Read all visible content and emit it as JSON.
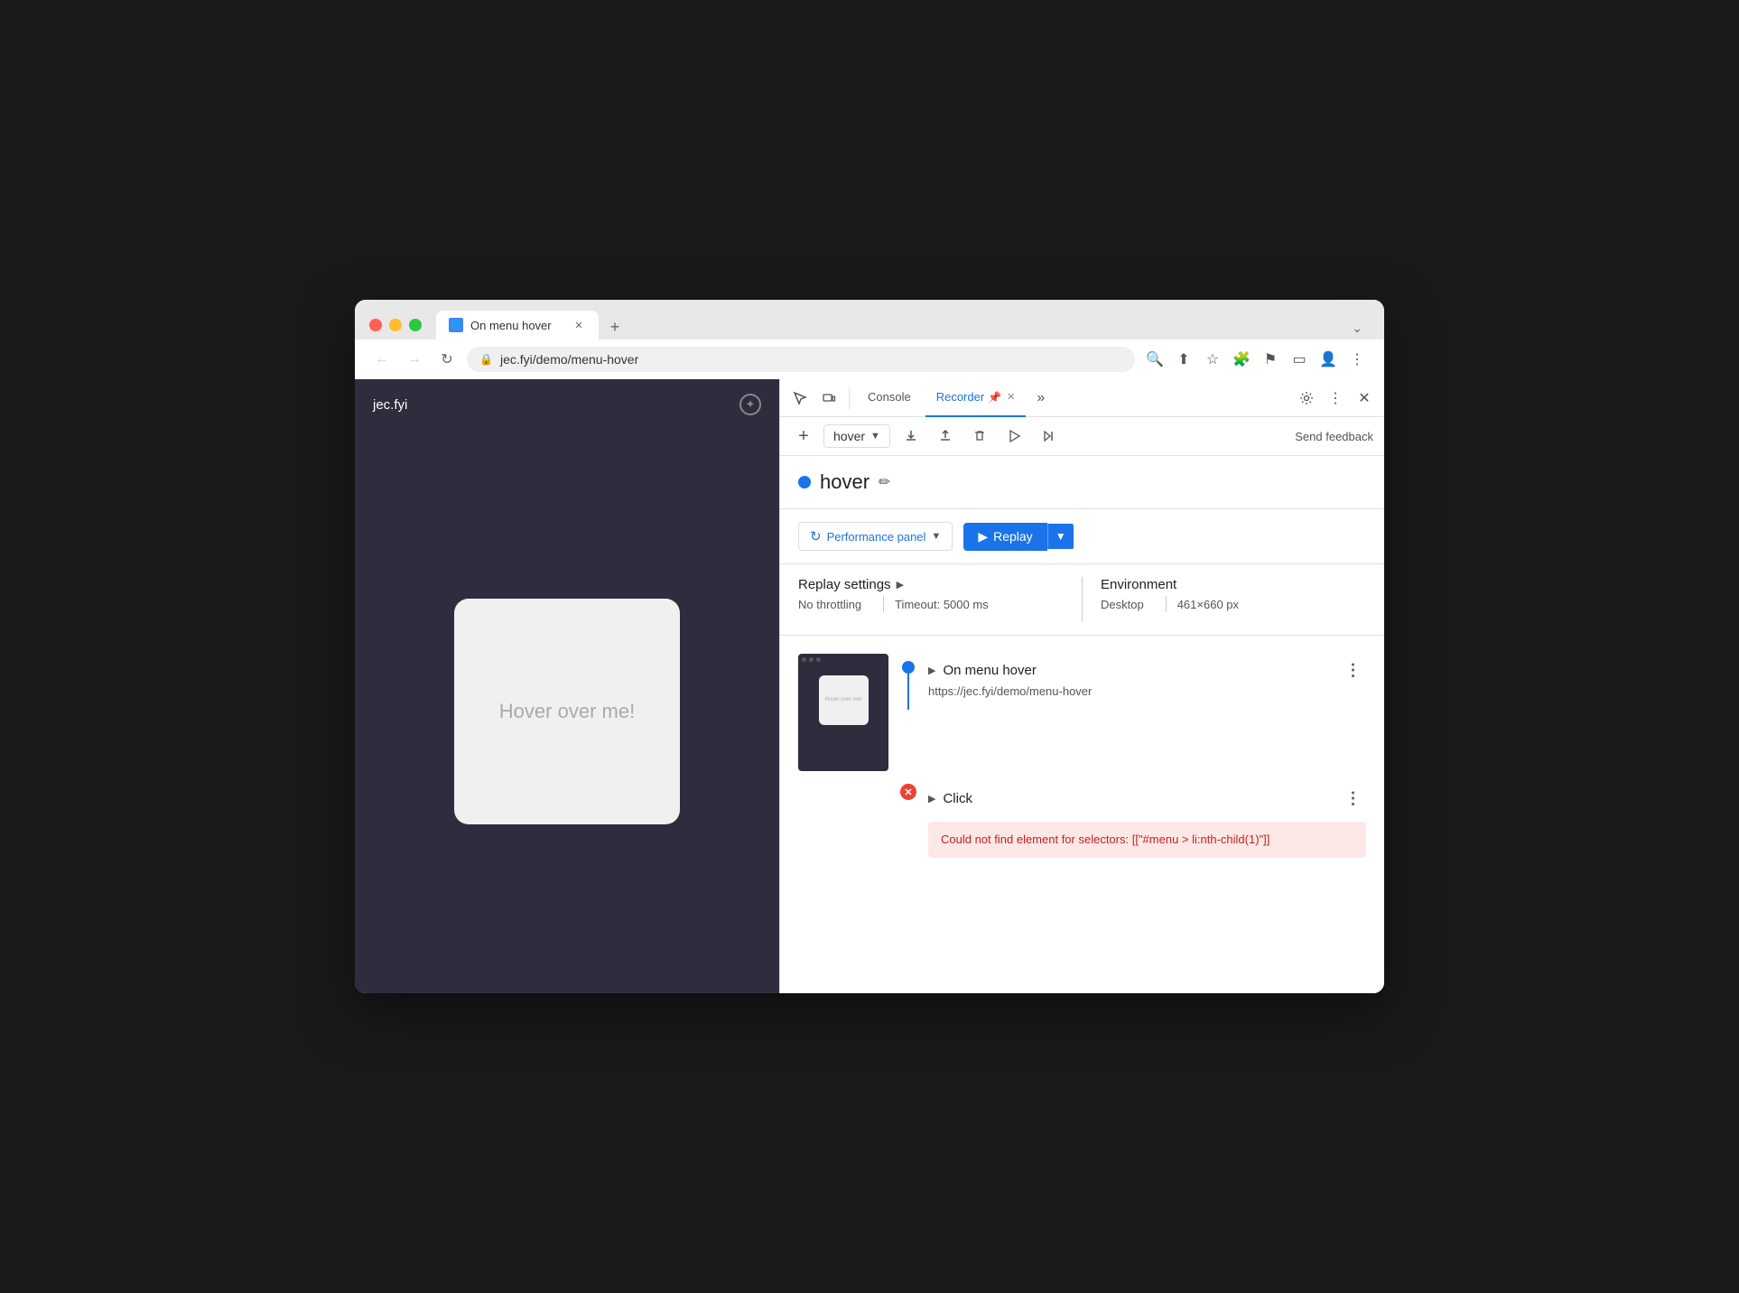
{
  "window": {
    "title": "On menu hover"
  },
  "tabs": [
    {
      "label": "On menu hover",
      "favicon": "🌐",
      "active": true
    }
  ],
  "address_bar": {
    "url": "jec.fyi/demo/menu-hover",
    "lock_icon": "🔒"
  },
  "devtools": {
    "tabs": [
      {
        "label": "Console",
        "active": false
      },
      {
        "label": "Recorder",
        "active": true
      }
    ],
    "toolbar": {
      "add_label": "+",
      "recording_name": "hover",
      "replay_label": "Replay",
      "send_feedback_label": "Send feedback",
      "more_label": "⋮"
    },
    "recording": {
      "name": "hover",
      "dot_color": "#1a73e8"
    },
    "replay_settings": {
      "title": "Replay settings",
      "arrow": "▶",
      "throttling": "No throttling",
      "timeout_label": "Timeout:",
      "timeout_value": "5000 ms",
      "environment_title": "Environment",
      "device": "Desktop",
      "dimensions": "461×660 px"
    },
    "steps": [
      {
        "type": "navigation",
        "title": "On menu hover",
        "url": "https://jec.fyi/demo/menu-hover",
        "status": "blue"
      },
      {
        "type": "click",
        "title": "Click",
        "status": "error",
        "error_message": "Could not find element for selectors: [[\"#menu > li:nth-child(1)\"]]"
      }
    ]
  },
  "website": {
    "domain": "jec.fyi",
    "hover_text": "Hover over me!"
  }
}
